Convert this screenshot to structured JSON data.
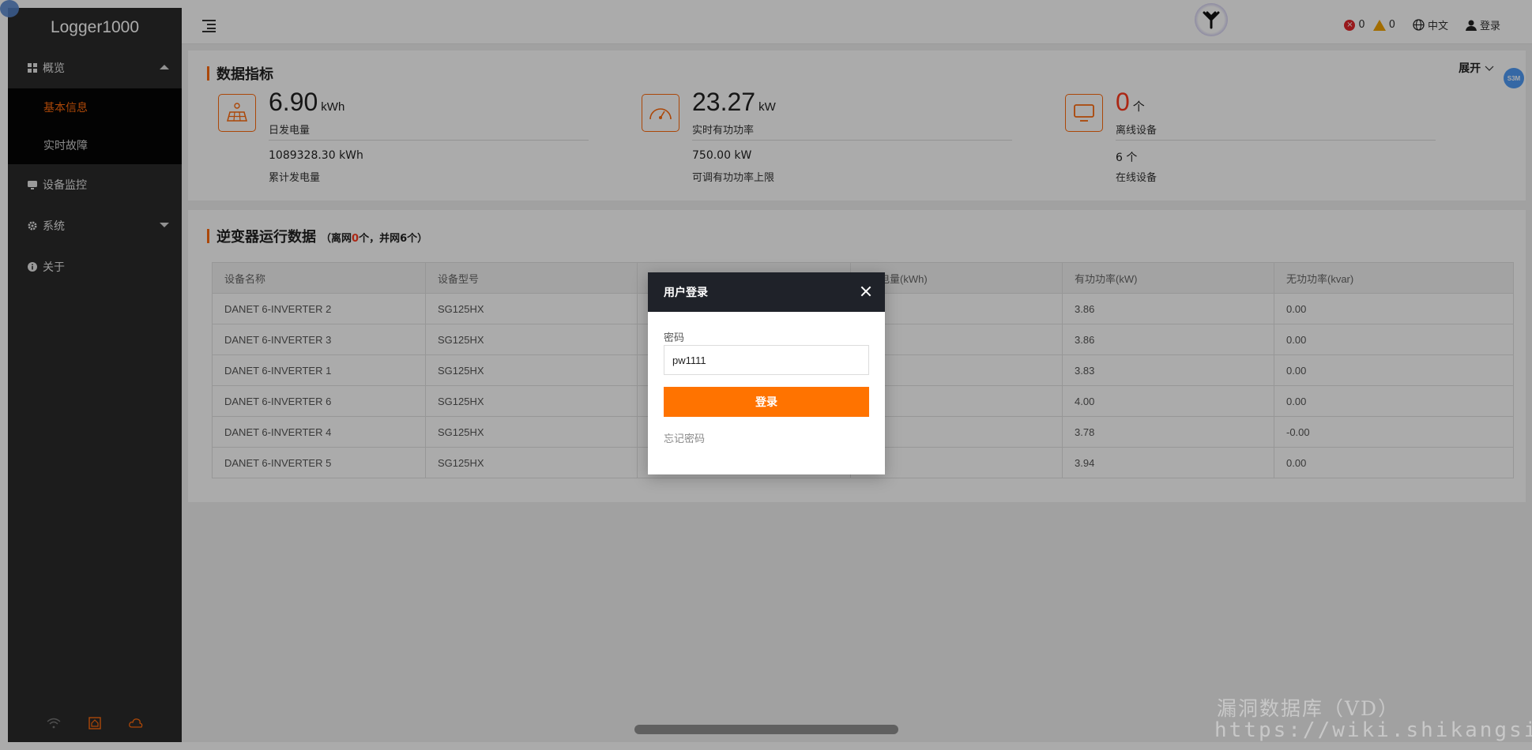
{
  "app": {
    "title": "Logger1000"
  },
  "sidebar": {
    "items": [
      {
        "label": "概览",
        "icon": "grid-icon",
        "expanded": true
      },
      {
        "label": "设备监控",
        "icon": "monitor-icon"
      },
      {
        "label": "系统",
        "icon": "gear-icon",
        "expanded": false
      },
      {
        "label": "关于",
        "icon": "info-icon"
      }
    ],
    "submenu": [
      {
        "label": "基本信息",
        "active": true
      },
      {
        "label": "实时故障",
        "active": false
      }
    ],
    "footer_icons": [
      "wifi-icon",
      "home-icon",
      "cloud-icon"
    ]
  },
  "header": {
    "error_count": "0",
    "warning_count": "0",
    "language": "中文",
    "login": "登录"
  },
  "metrics_card": {
    "title": "数据指标",
    "expand": "展开",
    "metrics": [
      {
        "icon": "solar-panel-icon",
        "value": "6.90",
        "unit": "kWh",
        "label": "日发电量",
        "secondary_value": "1089328.30 kWh",
        "secondary_label": "累计发电量"
      },
      {
        "icon": "gauge-icon",
        "value": "23.27",
        "unit": "kW",
        "label": "实时有功功率",
        "secondary_value": "750.00 kW",
        "secondary_label": "可调有功功率上限"
      },
      {
        "icon": "screen-icon",
        "value": "0",
        "unit": "个",
        "label": "离线设备",
        "secondary_value": "6 个",
        "secondary_label": "在线设备"
      }
    ]
  },
  "inverter_card": {
    "title": "逆变器运行数据",
    "subtitle_prefix": "（离网",
    "offline_count": "0",
    "subtitle_suffix": "个，并网6个）",
    "columns": [
      "设备名称",
      "设备型号",
      "",
      "电量(kWh)",
      "有功功率(kW)",
      "无功功率(kvar)"
    ],
    "rows": [
      [
        "DANET 6-INVERTER 2",
        "SG125HX",
        "",
        "",
        "3.86",
        "0.00"
      ],
      [
        "DANET 6-INVERTER 3",
        "SG125HX",
        "",
        "",
        "3.86",
        "0.00"
      ],
      [
        "DANET 6-INVERTER 1",
        "SG125HX",
        "",
        "",
        "3.83",
        "0.00"
      ],
      [
        "DANET 6-INVERTER 6",
        "SG125HX",
        "",
        "",
        "4.00",
        "0.00"
      ],
      [
        "DANET 6-INVERTER 4",
        "SG125HX",
        "",
        "",
        "3.78",
        "-0.00"
      ],
      [
        "DANET 6-INVERTER 5",
        "SG125HX",
        "",
        "",
        "3.94",
        "0.00"
      ]
    ]
  },
  "login_modal": {
    "title": "用户登录",
    "password_label": "密码",
    "password_value": "pw1111",
    "submit": "登录",
    "forgot": "忘记密码"
  },
  "badge": {
    "text": "S3M"
  },
  "watermark": {
    "line1": "漏洞数据库（VD）",
    "line2": "https://wiki.shikangsi.com"
  },
  "colors": {
    "accent": "#ff6a0c",
    "sidebar_bg": "#2a2a2a",
    "modal_header": "#1f2229",
    "error": "#e3262a",
    "warning": "#f2a300"
  }
}
